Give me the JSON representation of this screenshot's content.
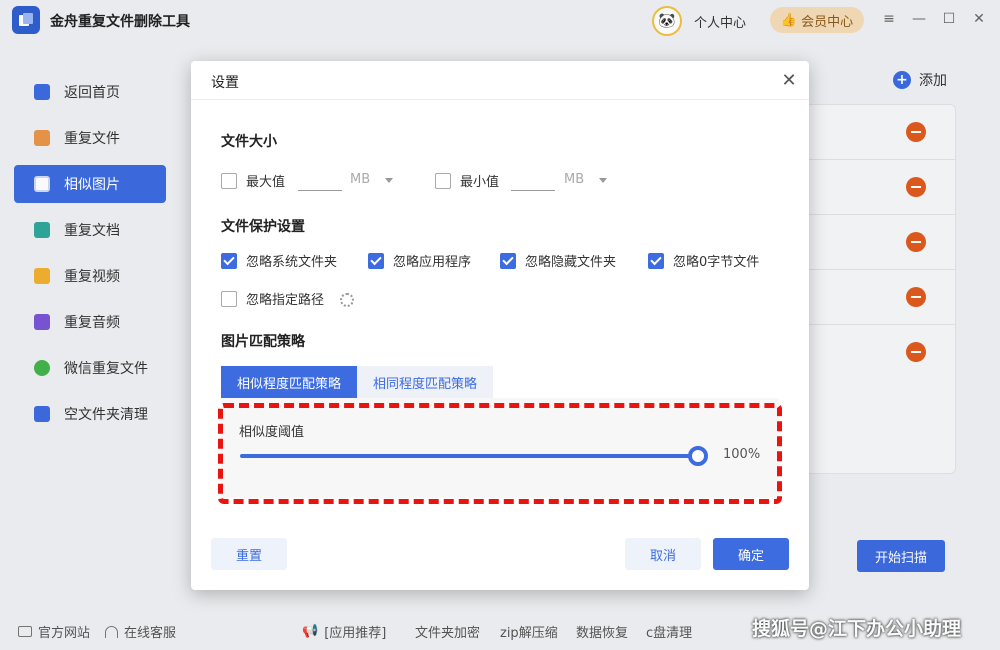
{
  "app": {
    "title": "金舟重复文件删除工具",
    "user_center": "个人中心",
    "vip_center": "会员中心"
  },
  "sidebar": {
    "items": [
      {
        "label": "返回首页",
        "icon": "home-icon",
        "color": "#3d6ce0"
      },
      {
        "label": "重复文件",
        "icon": "folder-icon",
        "color": "#e8954a"
      },
      {
        "label": "相似图片",
        "icon": "image-icon",
        "color": "#3d6ce0"
      },
      {
        "label": "重复文档",
        "icon": "document-icon",
        "color": "#2fa89a"
      },
      {
        "label": "重复视频",
        "icon": "video-icon",
        "color": "#f0b030"
      },
      {
        "label": "重复音频",
        "icon": "audio-icon",
        "color": "#7a55d6"
      },
      {
        "label": "微信重复文件",
        "icon": "wechat-icon",
        "color": "#43b44a"
      },
      {
        "label": "空文件夹清理",
        "icon": "empty-folder-icon",
        "color": "#3d6ce0"
      }
    ],
    "active_index": 2
  },
  "main": {
    "add_label": "添加",
    "start_scan_label": "开始扫描"
  },
  "footer": {
    "official_site": "官方网站",
    "online_service": "在线客服",
    "recommend": "[应用推荐]",
    "links": [
      "文件夹加密",
      "zip解压缩",
      "数据恢复",
      "c盘清理"
    ],
    "watermark": "搜狐号@江下办公小助理"
  },
  "settings": {
    "title": "设置",
    "file_size": {
      "heading": "文件大小",
      "max_label": "最大值",
      "min_label": "最小值",
      "max_checked": false,
      "min_checked": false,
      "unit": "MB"
    },
    "protection": {
      "heading": "文件保护设置",
      "options": [
        {
          "label": "忽略系统文件夹",
          "checked": true
        },
        {
          "label": "忽略应用程序",
          "checked": true
        },
        {
          "label": "忽略隐藏文件夹",
          "checked": true
        },
        {
          "label": "忽略0字节文件",
          "checked": true
        },
        {
          "label": "忽略指定路径",
          "checked": false
        }
      ]
    },
    "matching": {
      "heading": "图片匹配策略",
      "tabs": [
        "相似程度匹配策略",
        "相同程度匹配策略"
      ],
      "active_tab": 0,
      "threshold_label": "相似度阈值",
      "threshold_value": 1.0,
      "threshold_text": "100%"
    },
    "buttons": {
      "reset": "重置",
      "cancel": "取消",
      "ok": "确定"
    }
  },
  "colors": {
    "accent": "#3d6ce0",
    "danger": "#e05a1e",
    "highlight": "#e8140f"
  }
}
